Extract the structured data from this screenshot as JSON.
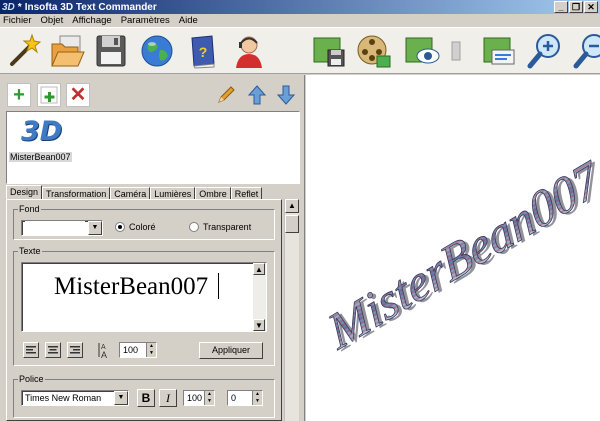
{
  "window": {
    "title": "Insofta 3D Text Commander",
    "icon_label": "3D",
    "prefix": "*"
  },
  "menu": [
    "Fichier",
    "Objet",
    "Affichage",
    "Paramètres",
    "Aide"
  ],
  "toolbar": {
    "icons": [
      "wizard-wand-icon",
      "open-folder-icon",
      "save-floppy-icon",
      "globe-icon",
      "help-book-icon",
      "support-agent-icon",
      "save-image-icon",
      "render-film-icon",
      "preview-eye-icon",
      "separator",
      "export-icon",
      "zoom-in-icon",
      "zoom-out-icon"
    ]
  },
  "objects": {
    "thumb_text": "3D",
    "items": [
      {
        "label": "MisterBean007"
      }
    ]
  },
  "tabs": [
    "Design",
    "Transformation",
    "Caméra",
    "Lumières",
    "Ombre",
    "Reflet"
  ],
  "active_tab": "Design",
  "design": {
    "fond": {
      "legend": "Fond",
      "color": "#ffffff",
      "options": [
        {
          "label": "Coloré",
          "selected": true
        },
        {
          "label": "Transparent",
          "selected": false
        }
      ]
    },
    "texte": {
      "legend": "Texte",
      "value": "MisterBean007",
      "scale": "100",
      "apply_label": "Appliquer"
    },
    "police": {
      "legend": "Police",
      "font": "Times New Roman",
      "bold_label": "B",
      "italic_label": "I",
      "size": "100",
      "spacing": "0"
    }
  },
  "preview": {
    "text": "MisterBean007",
    "colors": {
      "top": "#d8e0ea",
      "mid": "#5d7fb0",
      "bottom": "#f0f0f4",
      "accent": "#c0202a"
    }
  }
}
